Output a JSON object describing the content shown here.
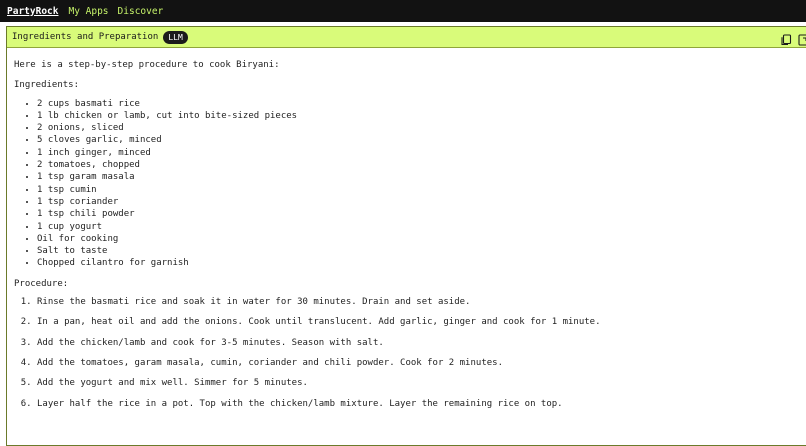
{
  "topbar": {
    "brand": "PartyRock",
    "links": [
      "My Apps",
      "Discover"
    ]
  },
  "panel": {
    "title": "Ingredients and Preparation",
    "badge": "LLM",
    "accent_color": "#d9fb7a"
  },
  "content": {
    "intro": "Here is a step-by-step procedure to cook Biryani:",
    "ingredients_heading": "Ingredients:",
    "ingredients": [
      "2 cups basmati rice",
      "1 lb chicken or lamb, cut into bite-sized pieces",
      "2 onions, sliced",
      "5 cloves garlic, minced",
      "1 inch ginger, minced",
      "2 tomatoes, chopped",
      "1 tsp garam masala",
      "1 tsp cumin",
      "1 tsp coriander",
      "1 tsp chili powder",
      "1 cup yogurt",
      "Oil for cooking",
      "Salt to taste",
      "Chopped cilantro for garnish"
    ],
    "procedure_heading": "Procedure:",
    "steps": [
      "Rinse the basmati rice and soak it in water for 30 minutes. Drain and set aside.",
      "In a pan, heat oil and add the onions. Cook until translucent. Add garlic, ginger and cook for 1 minute.",
      "Add the chicken/lamb and cook for 3-5 minutes. Season with salt.",
      "Add the tomatoes, garam masala, cumin, coriander and chili powder. Cook for 2 minutes.",
      "Add the yogurt and mix well. Simmer for 5 minutes.",
      "Layer half the rice in a pot. Top with the chicken/lamb mixture. Layer the remaining rice on top."
    ]
  },
  "icons": {
    "copy": "copy-icon",
    "expand": "expand-icon"
  }
}
